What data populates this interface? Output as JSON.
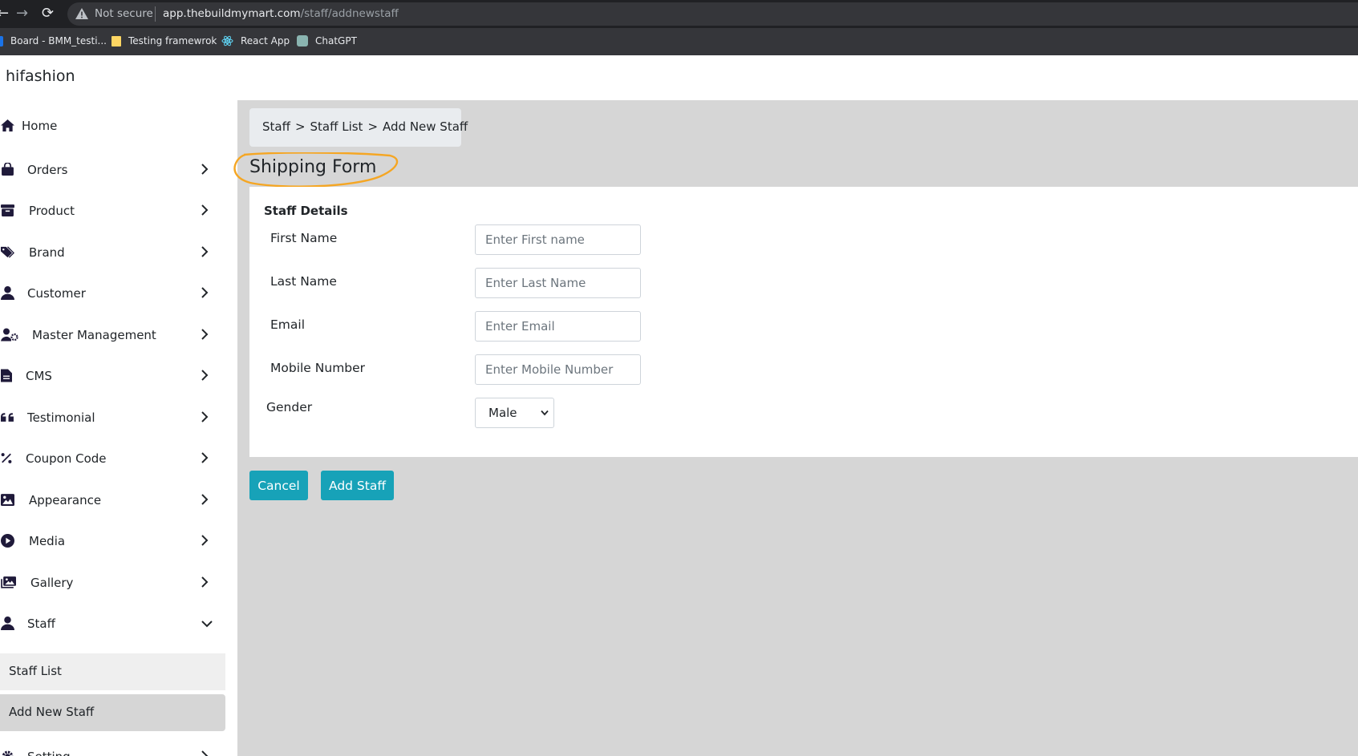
{
  "browser": {
    "nav": {
      "back": "←",
      "forward": "→",
      "reload": "⟳"
    },
    "security_label": "Not secure",
    "url_host": "app.thebuildmymart.com",
    "url_path": "/staff/addnewstaff",
    "bookmarks": [
      {
        "label": "Board - BMM_testi...",
        "icon": "trello-icon",
        "color": "#1a73e8"
      },
      {
        "label": "Testing framewrok",
        "icon": "folder-icon",
        "color": "#fdd663"
      },
      {
        "label": "React App",
        "icon": "react-icon",
        "color": "#61dafb"
      },
      {
        "label": "ChatGPT",
        "icon": "chatgpt-icon",
        "color": "#8ab4b0"
      }
    ]
  },
  "app": {
    "brand": "hifashion"
  },
  "sidebar": {
    "items": [
      {
        "label": "Home",
        "icon": "home-icon"
      },
      {
        "label": "Orders",
        "icon": "shopping-bag-icon"
      },
      {
        "label": "Product",
        "icon": "archive-icon"
      },
      {
        "label": "Brand",
        "icon": "tags-icon"
      },
      {
        "label": "Customer",
        "icon": "user-icon"
      },
      {
        "label": "Master Management",
        "icon": "user-gear-icon"
      },
      {
        "label": "CMS",
        "icon": "file-icon"
      },
      {
        "label": "Testimonial",
        "icon": "quote-icon"
      },
      {
        "label": "Coupon Code",
        "icon": "percent-icon"
      },
      {
        "label": "Appearance",
        "icon": "image-icon"
      },
      {
        "label": "Media",
        "icon": "play-circle-icon"
      },
      {
        "label": "Gallery",
        "icon": "images-icon"
      },
      {
        "label": "Staff",
        "icon": "user-icon"
      },
      {
        "label": "Setting",
        "icon": "gear-icon"
      }
    ],
    "staff_sub": [
      {
        "label": "Staff List"
      },
      {
        "label": "Add New Staff"
      }
    ]
  },
  "breadcrumb": {
    "items": [
      "Staff",
      "Staff List",
      "Add New Staff"
    ],
    "separator": ">"
  },
  "page_title": "Shipping Form",
  "form": {
    "section_title": "Staff Details",
    "fields": [
      {
        "label": "First Name",
        "placeholder": "Enter First name",
        "value": ""
      },
      {
        "label": "Last Name",
        "placeholder": "Enter Last Name",
        "value": ""
      },
      {
        "label": "Email",
        "placeholder": "Enter Email",
        "value": ""
      },
      {
        "label": "Mobile Number",
        "placeholder": "Enter Mobile Number",
        "value": ""
      }
    ],
    "gender": {
      "label": "Gender",
      "selected": "Male"
    }
  },
  "actions": {
    "cancel": "Cancel",
    "add": "Add Staff"
  },
  "colors": {
    "primary_button": "#17a2b8",
    "annotation_ring": "#f5a623",
    "sidebar_icon": "#1f1a3a",
    "content_bg": "#d6d6d6",
    "browser_dark": "#202124"
  }
}
